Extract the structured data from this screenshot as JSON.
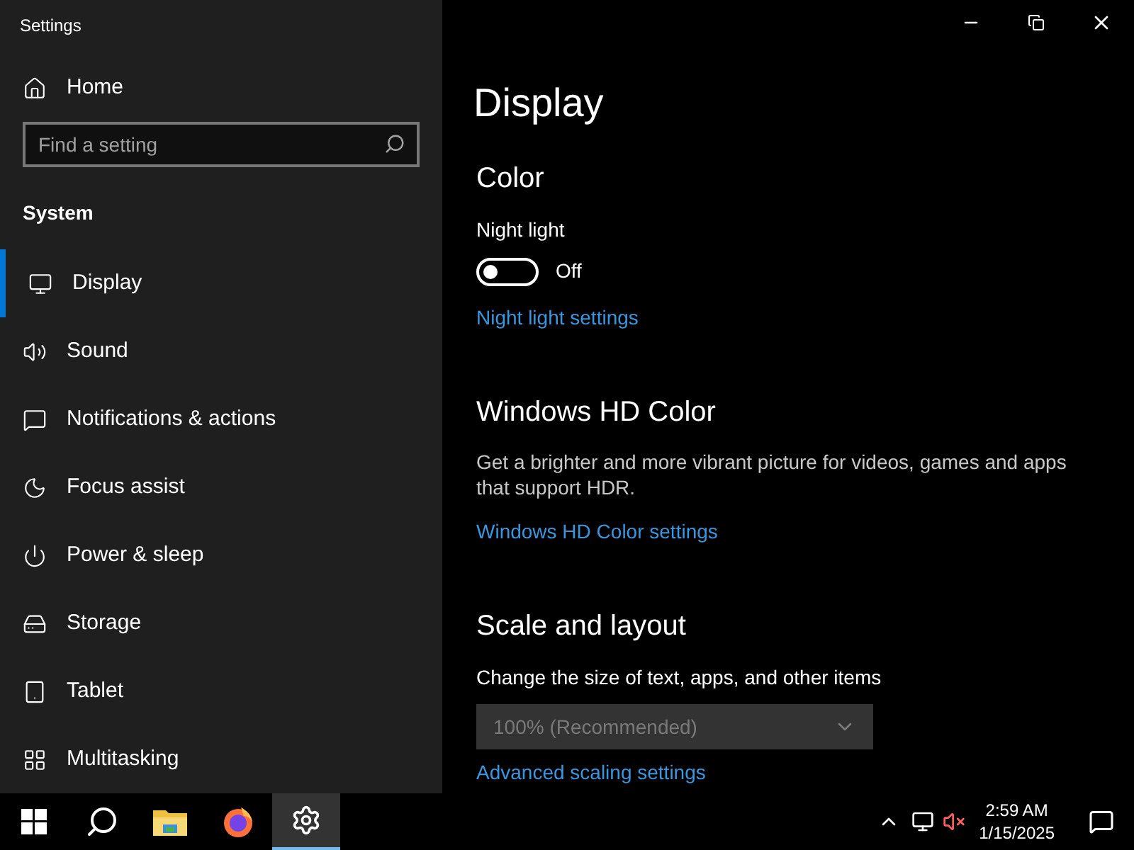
{
  "window": {
    "title": "Settings"
  },
  "sidebar": {
    "home": "Home",
    "search": {
      "placeholder": "Find a setting"
    },
    "section": "System",
    "items": [
      {
        "label": "Display",
        "kind": "display",
        "selected": true
      },
      {
        "label": "Sound",
        "kind": "sound",
        "selected": false
      },
      {
        "label": "Notifications & actions",
        "kind": "notifications",
        "selected": false
      },
      {
        "label": "Focus assist",
        "kind": "moon",
        "selected": false
      },
      {
        "label": "Power & sleep",
        "kind": "power",
        "selected": false
      },
      {
        "label": "Storage",
        "kind": "storage",
        "selected": false
      },
      {
        "label": "Tablet",
        "kind": "tablet",
        "selected": false
      },
      {
        "label": "Multitasking",
        "kind": "multitasking",
        "selected": false
      }
    ]
  },
  "content": {
    "title": "Display",
    "sections": [
      {
        "kind": "toggle",
        "heading": "Color",
        "label": "Night light",
        "on": false,
        "state_text": "Off",
        "link": "Night light settings"
      },
      {
        "kind": "text",
        "heading": "Windows HD Color",
        "description": "Get a brighter and more vibrant picture for videos, games and apps that support HDR.",
        "link": "Windows HD Color settings"
      },
      {
        "kind": "dropdown",
        "heading": "Scale and layout",
        "label": "Change the size of text, apps, and other items",
        "value": "100% (Recommended)",
        "disabled": true,
        "link": "Advanced scaling settings"
      }
    ]
  },
  "taskbar": {
    "apps": [
      {
        "kind": "start",
        "selected": false
      },
      {
        "kind": "search",
        "selected": false
      },
      {
        "kind": "explorer",
        "selected": false
      },
      {
        "kind": "browser",
        "selected": false
      },
      {
        "kind": "settings",
        "selected": true
      }
    ],
    "time": "2:59 AM",
    "date": "1/15/2025"
  }
}
